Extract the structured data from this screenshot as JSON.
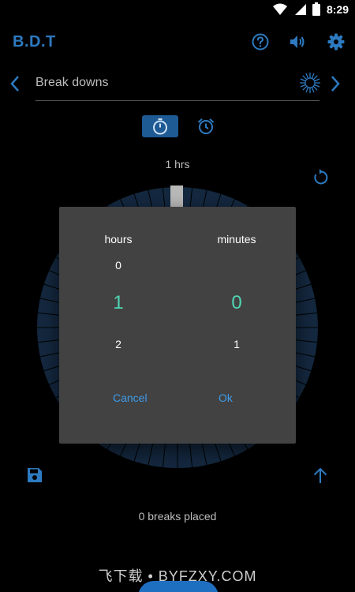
{
  "status_bar": {
    "time": "8:29",
    "icons": [
      "wifi-icon",
      "signal-icon",
      "battery-icon"
    ]
  },
  "app_bar": {
    "title": "B.D.T",
    "actions": [
      "help-icon",
      "volume-icon",
      "settings-icon"
    ]
  },
  "selector": {
    "label": "Break downs"
  },
  "duration_label": "1 hrs",
  "breaks_label": "0 breaks placed",
  "watermark": "飞下载 • BYFZXY.COM",
  "dialog": {
    "hours": {
      "label": "hours",
      "prev": "0",
      "current": "1",
      "next": "2"
    },
    "minutes": {
      "label": "minutes",
      "prev": "",
      "current": "0",
      "next": "1"
    },
    "cancel_label": "Cancel",
    "ok_label": "Ok"
  },
  "colors": {
    "accent": "#2d7ac0",
    "picker_selected": "#4fd6b3",
    "dialog_bg": "#424242",
    "dialog_button": "#3d9be9",
    "dial_fill": "#14283f"
  }
}
